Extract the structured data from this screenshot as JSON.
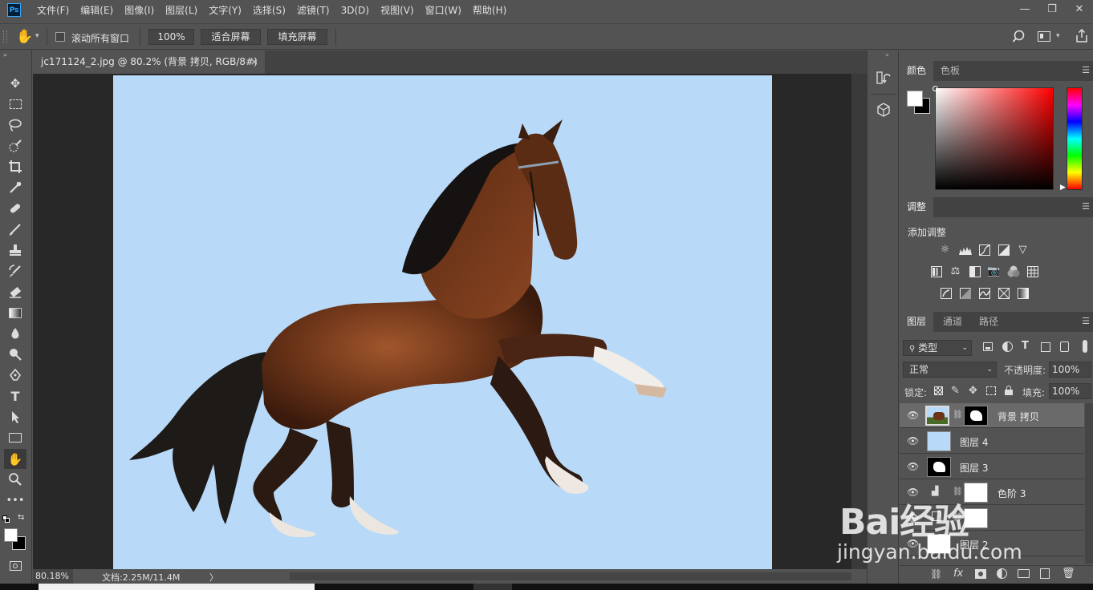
{
  "app": {
    "logo_text": "Ps"
  },
  "menu": [
    "文件(F)",
    "编辑(E)",
    "图像(I)",
    "图层(L)",
    "文字(Y)",
    "选择(S)",
    "滤镜(T)",
    "3D(D)",
    "视图(V)",
    "窗口(W)",
    "帮助(H)"
  ],
  "window_controls": {
    "minimize": "—",
    "restore": "❐",
    "close": "✕"
  },
  "options": {
    "scroll_all_label": "滚动所有窗口",
    "zoom_value": "100%",
    "fit_screen_label": "适合屏幕",
    "fill_screen_label": "填充屏幕"
  },
  "document": {
    "tab_title": "jc171124_2.jpg @ 80.2% (背景 拷贝, RGB/8#) *",
    "tab_close": "×"
  },
  "status": {
    "zoom": "80.18%",
    "doc_info": "文档:2.25M/11.4M",
    "arrow": "〉"
  },
  "panels": {
    "color_tab": "颜色",
    "swatches_tab": "色板",
    "adjustments_tab": "调整",
    "adjustments_add_label": "添加调整",
    "layers_tab": "图层",
    "channels_tab": "通道",
    "paths_tab": "路径"
  },
  "layers_panel": {
    "filter_kind": "类型",
    "blend_mode": "正常",
    "opacity_label": "不透明度:",
    "opacity_value": "100%",
    "lock_label": "锁定:",
    "fill_label": "填充:",
    "fill_value": "100%",
    "layers": [
      {
        "name": "背景 拷贝",
        "selected": true
      },
      {
        "name": "图层 4",
        "selected": false
      },
      {
        "name": "图层 3",
        "selected": false
      },
      {
        "name": "色阶 3",
        "selected": false
      },
      {
        "name": "",
        "selected": false
      },
      {
        "name": "图层 2",
        "selected": false
      }
    ],
    "bottom_fx": "fx"
  },
  "watermark": {
    "brand": "Bai经验",
    "url": "jingyan.baidu.com"
  },
  "colors": {
    "ui_bg": "#535353",
    "canvas_bg": "#b8d9f8",
    "selected_row": "#6a6a6a",
    "ps_blue": "#31a8ff"
  }
}
